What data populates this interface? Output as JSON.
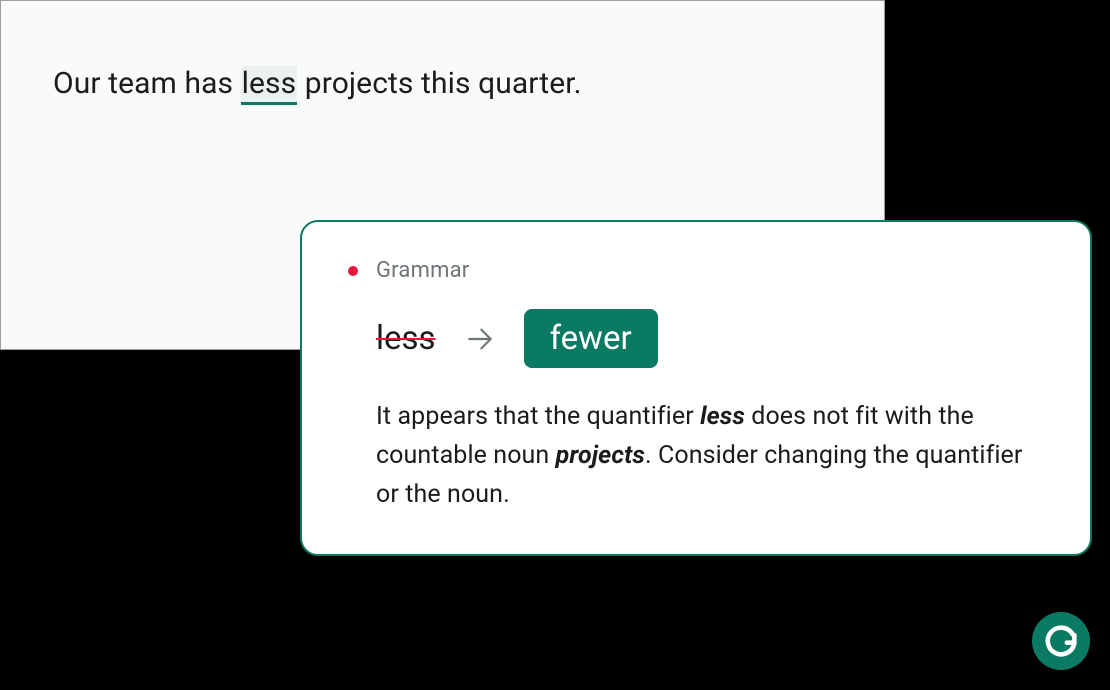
{
  "colors": {
    "accent": "#0b7a63",
    "error": "#e5163b",
    "panel_bg": "#f9fafa",
    "panel_border": "#9e9e9e"
  },
  "editor": {
    "sentence_before": "Our team has ",
    "highlighted": "less",
    "sentence_after": " projects this quarter."
  },
  "suggestion": {
    "category": "Grammar",
    "wrong_word": "less",
    "corrected_word": "fewer",
    "explanation_parts": {
      "t1": "It appears that the quantifier ",
      "b1": "less",
      "t2": " does not fit with the countable noun ",
      "b2": "projects",
      "t3": ". Consider changing the quantifier or the noun."
    }
  },
  "brand": {
    "name": "grammarly-badge"
  }
}
